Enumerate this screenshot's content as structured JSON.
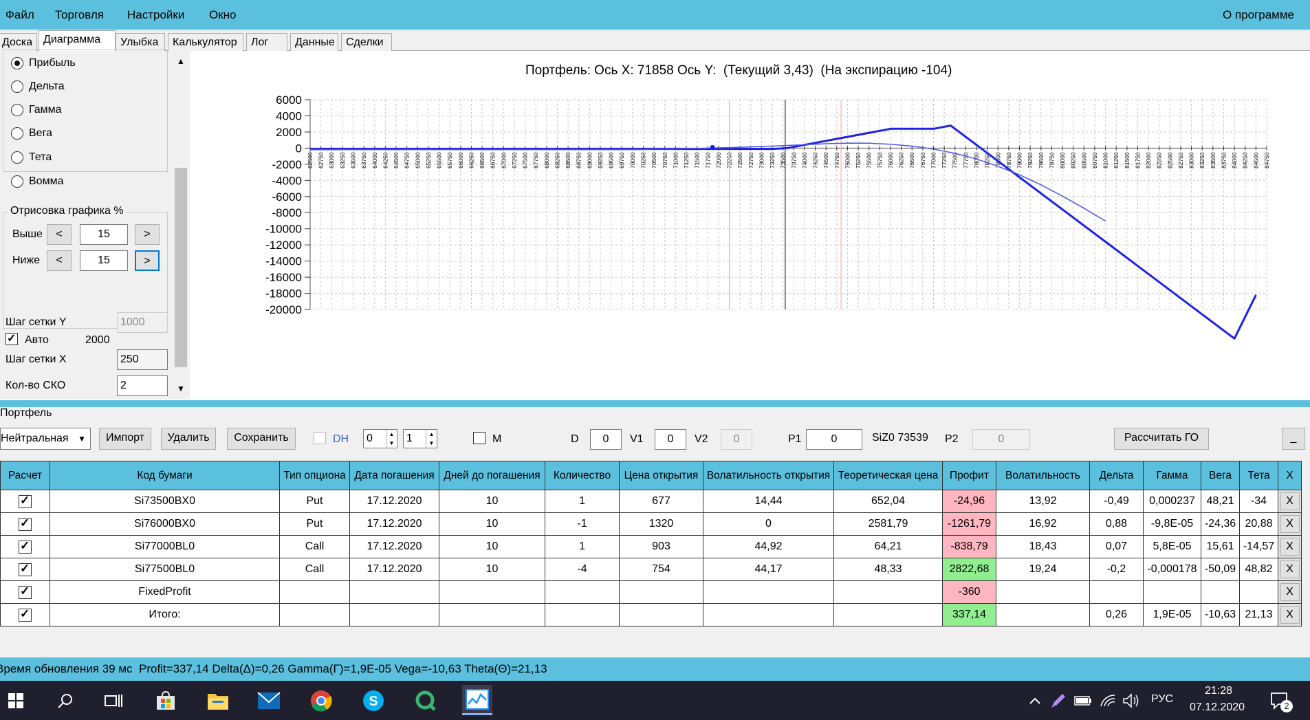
{
  "menu": {
    "file": "Файл",
    "trade": "Торговля",
    "settings": "Настройки",
    "window": "Окно",
    "about": "О программе"
  },
  "tabs": [
    "Доска",
    "Диаграмма",
    "Улыбка",
    "Калькулятор",
    "Лог",
    "Данные",
    "Сделки"
  ],
  "left": {
    "radios": [
      {
        "label": "Прибыль",
        "checked": true
      },
      {
        "label": "Дельта",
        "checked": false
      },
      {
        "label": "Гамма",
        "checked": false
      },
      {
        "label": "Вега",
        "checked": false
      },
      {
        "label": "Тета",
        "checked": false
      },
      {
        "label": "Вомма",
        "checked": false
      }
    ],
    "render_group_title": "Отрисовка графика %",
    "above_label": "Выше",
    "above_value": "15",
    "below_label": "Ниже",
    "below_value": "15",
    "prev_btn": "<",
    "next_btn": ">",
    "grid_step_y_label": "Шаг сетки Y",
    "grid_step_y_value": "1000",
    "auto_label": "Авто",
    "auto_value": "2000",
    "grid_step_x_label": "Шаг сетки X",
    "grid_step_x_value": "250",
    "sko_label": "Кол-во СКО",
    "sko_value": "2"
  },
  "chart_data": {
    "type": "line",
    "title": "Портфель: Ось X: 71858 Ось Y:  (Текущий 3,43)  (На экспирацию -104)",
    "xlabel": "",
    "ylabel": "",
    "ylim": [
      -20000,
      6000
    ],
    "xlim": [
      62500,
      84750
    ],
    "yticks": [
      6000,
      4000,
      2000,
      0,
      -2000,
      -4000,
      -6000,
      -8000,
      -10000,
      -12000,
      -14000,
      -16000,
      -18000,
      -20000
    ],
    "xtick_step": 250,
    "grid": true,
    "current_price": 71858,
    "vertical_lines": [
      {
        "x": 72250,
        "color": "#ff9999"
      },
      {
        "x": 73550,
        "color": "#555555"
      },
      {
        "x": 74850,
        "color": "#ff9999"
      }
    ],
    "series": [
      {
        "color": "#1e22e6",
        "width": 3,
        "x": [
          62500,
          73250,
          73600,
          74000,
          75000,
          76000,
          76500,
          77000,
          77400,
          77500,
          78000,
          79000,
          80000,
          81000,
          82000,
          83000,
          84000,
          84500
        ],
        "y": [
          -104,
          -104,
          0,
          396,
          1396,
          2396,
          2396,
          2396,
          2796,
          2396,
          396,
          -3604,
          -7604,
          -11604,
          -15604,
          -19604,
          -23604,
          -18200
        ]
      },
      {
        "color": "#4a55ee",
        "width": 1.5,
        "x": [
          62500,
          70000,
          71000,
          71858,
          72500,
          73000,
          73500,
          74000,
          74500,
          75000,
          75500,
          76000,
          76500,
          77000,
          77500,
          78000,
          78500,
          79000,
          79500,
          80000,
          80500,
          81000
        ],
        "y": [
          -200,
          -180,
          -120,
          3,
          110,
          200,
          310,
          420,
          540,
          620,
          600,
          480,
          250,
          -120,
          -650,
          -1350,
          -2250,
          -3300,
          -4550,
          -5950,
          -7450,
          -9050
        ]
      }
    ]
  },
  "portfolio": {
    "group_title": "Портфель",
    "strategy": "Нейтральная",
    "import_btn": "Импорт",
    "delete_btn": "Удалить",
    "save_btn": "Сохранить",
    "dh_label": "DH",
    "spin1": "0",
    "spin2": "1",
    "m_label": "M",
    "d_label": "D",
    "d_value": "0",
    "v1_label": "V1",
    "v1_value": "0",
    "v2_label": "V2",
    "v2_value": "0",
    "p1_label": "P1",
    "p1_value": "0",
    "siz_label": "SiZ0 73539",
    "p2_label": "P2",
    "p2_value": "0",
    "calc_go_btn": "Рассчитать ГО",
    "minimize_btn": "_"
  },
  "table": {
    "headers": [
      "Расчет",
      "Код бумаги",
      "Тип опциона",
      "Дата погашения",
      "Дней до погашения",
      "Количество",
      "Цена открытия",
      "Волатильность открытия",
      "Теоретическая цена",
      "Профит",
      "Волатильность",
      "Дельта",
      "Гамма",
      "Вега",
      "Тета",
      "X"
    ],
    "rows": [
      {
        "code": "Si73500BX0",
        "type": "Put",
        "date": "17.12.2020",
        "days": "10",
        "qty": "1",
        "open": "677",
        "vol_open": "14,44",
        "theo": "652,04",
        "profit": "-24,96",
        "profit_color": "red",
        "vol": "13,92",
        "delta": "-0,49",
        "gamma": "0,000237",
        "vega": "48,21",
        "theta": "-34"
      },
      {
        "code": "Si76000BX0",
        "type": "Put",
        "date": "17.12.2020",
        "days": "10",
        "qty": "-1",
        "open": "1320",
        "vol_open": "0",
        "theo": "2581,79",
        "profit": "-1261,79",
        "profit_color": "red",
        "vol": "16,92",
        "delta": "0,88",
        "gamma": "-9,8E-05",
        "vega": "-24,36",
        "theta": "20,88"
      },
      {
        "code": "Si77000BL0",
        "type": "Call",
        "date": "17.12.2020",
        "days": "10",
        "qty": "1",
        "open": "903",
        "vol_open": "44,92",
        "theo": "64,21",
        "profit": "-838,79",
        "profit_color": "red",
        "vol": "18,43",
        "delta": "0,07",
        "gamma": "5,8E-05",
        "vega": "15,61",
        "theta": "-14,57"
      },
      {
        "code": "Si77500BL0",
        "type": "Call",
        "date": "17.12.2020",
        "days": "10",
        "qty": "-4",
        "open": "754",
        "vol_open": "44,17",
        "theo": "48,33",
        "profit": "2822,68",
        "profit_color": "green",
        "vol": "19,24",
        "delta": "-0,2",
        "gamma": "-0,000178",
        "vega": "-50,09",
        "theta": "48,82"
      },
      {
        "code": "FixedProfit",
        "type": "",
        "date": "",
        "days": "",
        "qty": "",
        "open": "",
        "vol_open": "",
        "theo": "",
        "profit": "-360",
        "profit_color": "red",
        "vol": "",
        "delta": "",
        "gamma": "",
        "vega": "",
        "theta": ""
      },
      {
        "code": "Итого:",
        "type": "",
        "date": "",
        "days": "",
        "qty": "",
        "open": "",
        "vol_open": "",
        "theo": "",
        "profit": "337,14",
        "profit_color": "green",
        "vol": "",
        "delta": "0,26",
        "gamma": "1,9E-05",
        "vega": "-10,63",
        "theta": "21,13"
      }
    ],
    "x_label": "X"
  },
  "status": {
    "text": "Время обновления 39 мс  Profit=337,14 Delta(Δ)=0,26 Gamma(Γ)=1,9E-05 Vega=-10,63 Theta(Θ)=21,13"
  },
  "taskbar": {
    "lang": "РУС",
    "time": "21:28",
    "date": "07.12.2020",
    "notif_count": "2"
  }
}
